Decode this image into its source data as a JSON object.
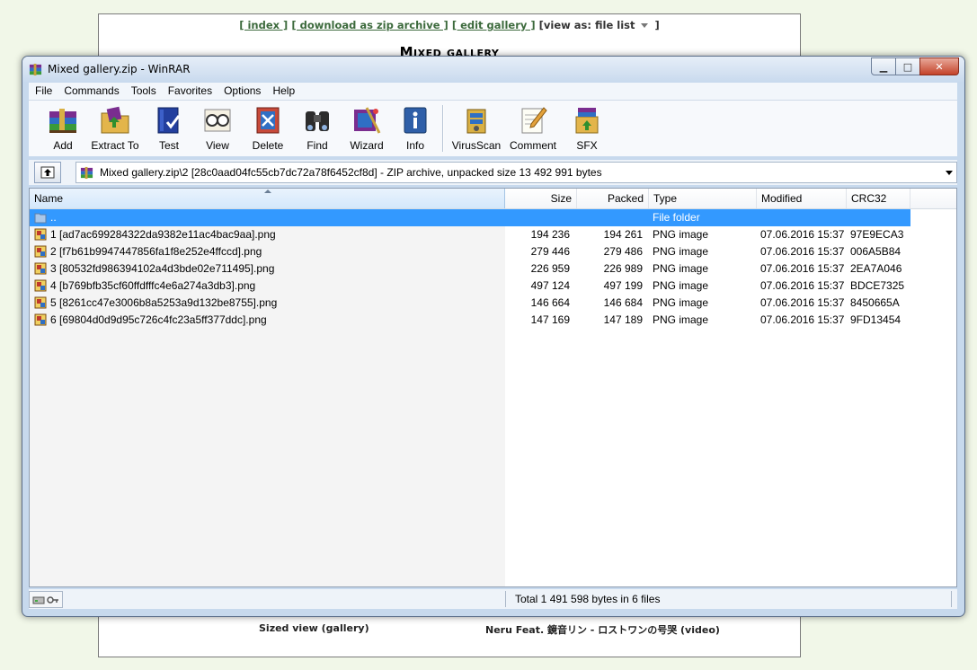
{
  "background_page": {
    "nav": {
      "index": "[ index ]",
      "zip": "[ download as zip archive ]",
      "edit": "[ edit gallery ]",
      "view_as_label": "[view as:",
      "view_as_value": "file list",
      "close_bracket": "]"
    },
    "title": "Mixed gallery",
    "footer_left": "Sized view (gallery)",
    "footer_right": "Neru Feat. 鏡音リン - ロストワンの号哭 (video)"
  },
  "window": {
    "title": "Mixed gallery.zip - WinRAR",
    "min_symbol": "▁",
    "max_symbol": "□",
    "close_symbol": "✕"
  },
  "menu": [
    "File",
    "Commands",
    "Tools",
    "Favorites",
    "Options",
    "Help"
  ],
  "toolbar": [
    {
      "label": "Add",
      "icon": "winrar-books-icon"
    },
    {
      "label": "Extract To",
      "icon": "extract-folder-icon"
    },
    {
      "label": "Test",
      "icon": "test-book-icon"
    },
    {
      "label": "View",
      "icon": "glasses-icon"
    },
    {
      "label": "Delete",
      "icon": "delete-book-icon"
    },
    {
      "label": "Find",
      "icon": "binoculars-icon"
    },
    {
      "label": "Wizard",
      "icon": "wizard-icon"
    },
    {
      "label": "Info",
      "icon": "info-icon"
    },
    {
      "label": "VirusScan",
      "icon": "virusscan-icon"
    },
    {
      "label": "Comment",
      "icon": "comment-pencil-icon"
    },
    {
      "label": "SFX",
      "icon": "sfx-box-icon"
    }
  ],
  "address": {
    "path": "Mixed gallery.zip\\2 [28c0aad04fc55cb7dc72a78f6452cf8d] - ZIP archive, unpacked size 13 492 991 bytes"
  },
  "columns": {
    "name": "Name",
    "size": "Size",
    "packed": "Packed",
    "type": "Type",
    "modified": "Modified",
    "crc": "CRC32"
  },
  "parent_row": {
    "name": "..",
    "type": "File folder"
  },
  "files": [
    {
      "name": "1 [ad7ac699284322da9382e11ac4bac9aa].png",
      "size": "194 236",
      "packed": "194 261",
      "type": "PNG image",
      "modified": "07.06.2016 15:37",
      "crc": "97E9ECA3"
    },
    {
      "name": "2 [f7b61b9947447856fa1f8e252e4ffccd].png",
      "size": "279 446",
      "packed": "279 486",
      "type": "PNG image",
      "modified": "07.06.2016 15:37",
      "crc": "006A5B84"
    },
    {
      "name": "3 [80532fd986394102a4d3bde02e711495].png",
      "size": "226 959",
      "packed": "226 989",
      "type": "PNG image",
      "modified": "07.06.2016 15:37",
      "crc": "2EA7A046"
    },
    {
      "name": "4 [b769bfb35cf60ffdfffc4e6a274a3db3].png",
      "size": "497 124",
      "packed": "497 199",
      "type": "PNG image",
      "modified": "07.06.2016 15:37",
      "crc": "BDCE7325"
    },
    {
      "name": "5 [8261cc47e3006b8a5253a9d132be8755].png",
      "size": "146 664",
      "packed": "146 684",
      "type": "PNG image",
      "modified": "07.06.2016 15:37",
      "crc": "8450665A"
    },
    {
      "name": "6 [69804d0d9d95c726c4fc23a5ff377ddc].png",
      "size": "147 169",
      "packed": "147 189",
      "type": "PNG image",
      "modified": "07.06.2016 15:37",
      "crc": "9FD13454"
    }
  ],
  "status": {
    "total": "Total 1 491 598 bytes in 6 files"
  },
  "colors": {
    "selection": "#3399ff",
    "window_frame": "#c7d9ed",
    "desktop": "#f1f7e8"
  }
}
